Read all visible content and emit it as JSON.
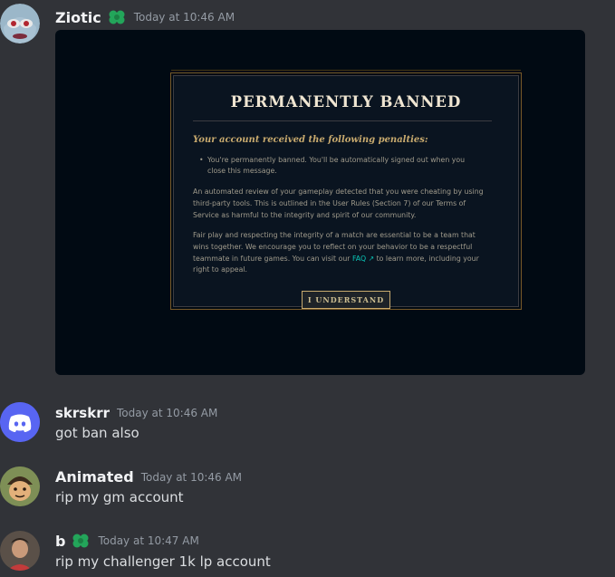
{
  "messages": [
    {
      "username": "Ziotic",
      "timestamp": "Today at 10:46 AM",
      "username_color": "#f2f3f5"
    },
    {
      "username": "skrskrr",
      "timestamp": "Today at 10:46 AM",
      "text": "got ban also"
    },
    {
      "username": "Animated",
      "timestamp": "Today at 10:46 AM",
      "text": "rip my gm account"
    },
    {
      "username": "b",
      "timestamp": "Today at 10:47 AM",
      "text": "rip my challenger 1k lp account"
    }
  ],
  "embed": {
    "title": "PERMANENTLY BANNED",
    "subtitle": "Your account received the following penalties:",
    "bullet_line1": "You're permanently banned. You'll be automatically signed out when you",
    "bullet_line2": "close this message.",
    "para1_line1": "An automated review of your gameplay detected that you were cheating by using",
    "para1_line2": "third-party tools. This is outlined in the User Rules (Section 7) of our Terms of",
    "para1_line3": "Service as harmful to the integrity and spirit of our community.",
    "para2_line1": "Fair play and respecting the integrity of a match are essential to be a team that",
    "para2_line2": "wins together. We encourage you to reflect on your behavior to be a respectful",
    "para2_line3a": "teammate in future games. You can visit our",
    "faq_label": "FAQ ↗",
    "para2_line3b": "to learn more, including your",
    "para2_line4": "right to appeal.",
    "button_label": "I UNDERSTAND"
  },
  "colors": {
    "background": "#313338",
    "badge_green": "#23a55a",
    "discord_blurple": "#5865f2",
    "gold": "#c8aa6e"
  },
  "icons": [
    "ziotic-avatar",
    "green-badge-icon",
    "discord-default-avatar-icon",
    "animated-avatar",
    "b-avatar"
  ]
}
